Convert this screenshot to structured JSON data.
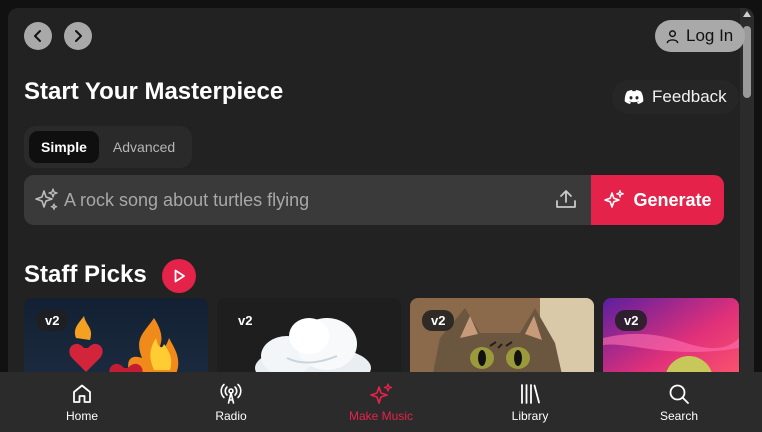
{
  "header": {
    "back_icon": "chevron-left-icon",
    "forward_icon": "chevron-right-icon",
    "login_label": "Log In"
  },
  "main": {
    "title": "Start Your Masterpiece",
    "feedback_label": "Feedback",
    "mode_tabs": [
      {
        "label": "Simple",
        "active": true
      },
      {
        "label": "Advanced",
        "active": false
      }
    ],
    "prompt": {
      "placeholder": "A rock song about turtles flying",
      "generate_label": "Generate"
    }
  },
  "staff_picks": {
    "title": "Staff Picks",
    "cards": [
      {
        "badge": "v2"
      },
      {
        "badge": "v2"
      },
      {
        "badge": "v2"
      },
      {
        "badge": "v2"
      }
    ]
  },
  "bottom_nav": {
    "items": [
      {
        "label": "Home",
        "icon": "home-icon",
        "active": false
      },
      {
        "label": "Radio",
        "icon": "radio-icon",
        "active": false
      },
      {
        "label": "Make Music",
        "icon": "sparkle-icon",
        "active": true
      },
      {
        "label": "Library",
        "icon": "library-icon",
        "active": false
      },
      {
        "label": "Search",
        "icon": "search-icon",
        "active": false
      }
    ]
  },
  "colors": {
    "accent": "#e5234a",
    "background": "#222222",
    "nav_background": "#2b2b2b"
  }
}
